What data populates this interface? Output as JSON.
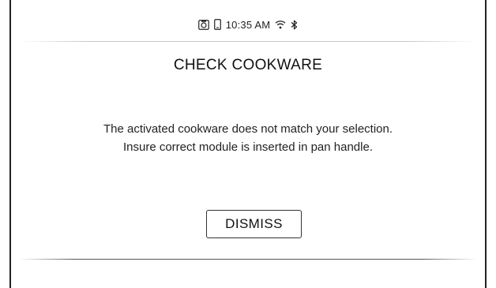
{
  "status_bar": {
    "time": "10:35 AM",
    "icons": [
      "camera-icon",
      "phone-icon",
      "wifi-icon",
      "bluetooth-icon"
    ]
  },
  "dialog": {
    "title": "CHECK COOKWARE",
    "message_line_1": "The activated cookware does not match your selection.",
    "message_line_2": "Insure correct module is inserted in pan handle.",
    "dismiss_label": "DISMISS"
  }
}
